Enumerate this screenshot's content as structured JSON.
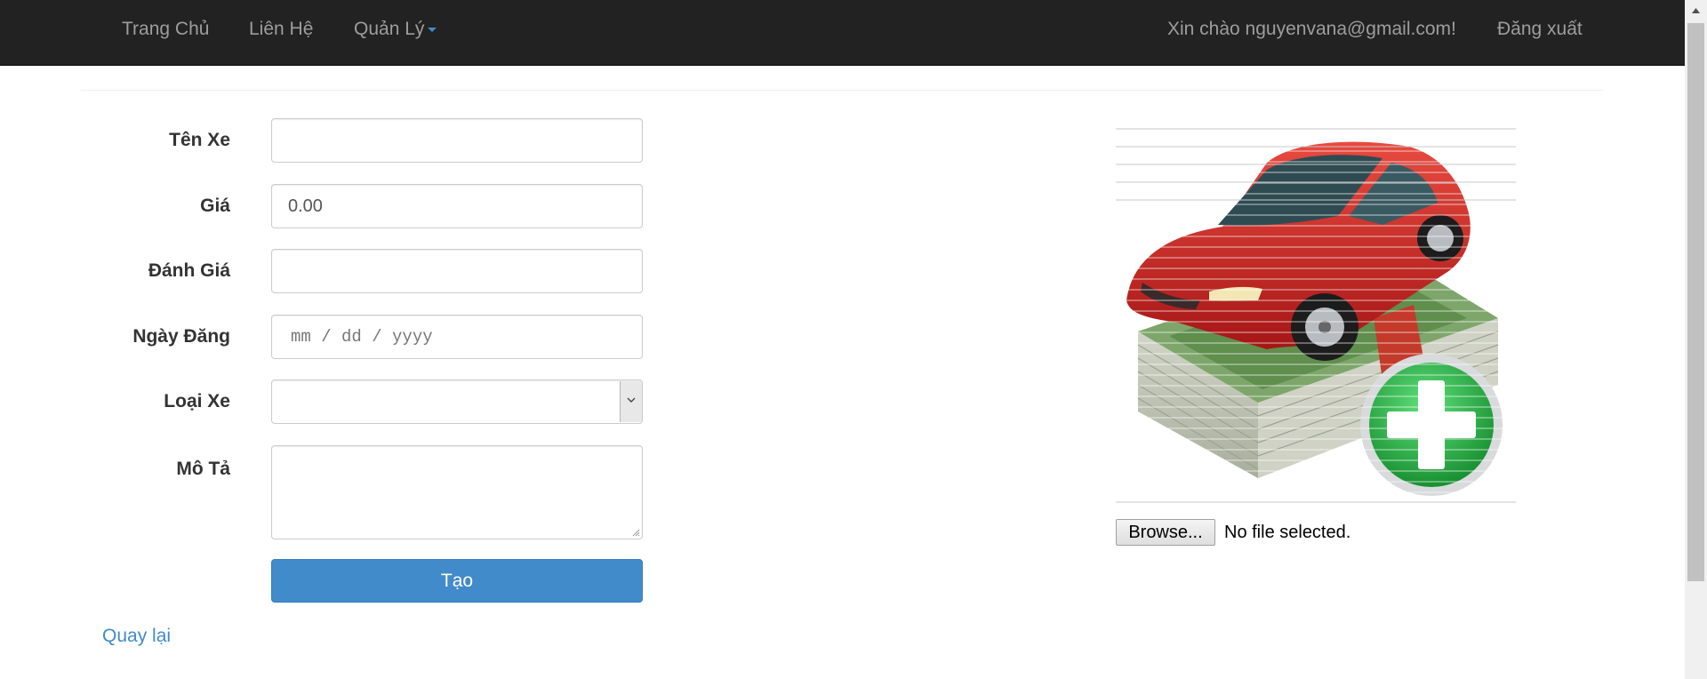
{
  "nav": {
    "home": "Trang Chủ",
    "contact": "Liên Hệ",
    "manage": "Quản Lý",
    "greeting": "Xin chào nguyenvana@gmail.com!",
    "logout": "Đăng xuất"
  },
  "form": {
    "name": {
      "label": "Tên Xe",
      "value": ""
    },
    "price": {
      "label": "Giá",
      "value": "0.00"
    },
    "rating": {
      "label": "Đánh Giá",
      "value": ""
    },
    "date": {
      "label": "Ngày Đăng",
      "placeholder": "mm / dd / yyyy"
    },
    "type": {
      "label": "Loại Xe",
      "selected": ""
    },
    "description": {
      "label": "Mô Tả",
      "value": ""
    },
    "submit": "Tạo"
  },
  "back": "Quay lại",
  "upload": {
    "browse": "Browse...",
    "status": "No file selected."
  },
  "colors": {
    "navbar": "#222222",
    "nav_text": "#9d9d9d",
    "primary": "#428bca",
    "car_red": "#d62b2b",
    "money_green": "#7ea66b",
    "badge_green": "#2fb24a"
  },
  "icons": {
    "caret": "caret-down-icon",
    "select_arrow": "chevron-down-icon",
    "preview": "add-car-icon"
  }
}
